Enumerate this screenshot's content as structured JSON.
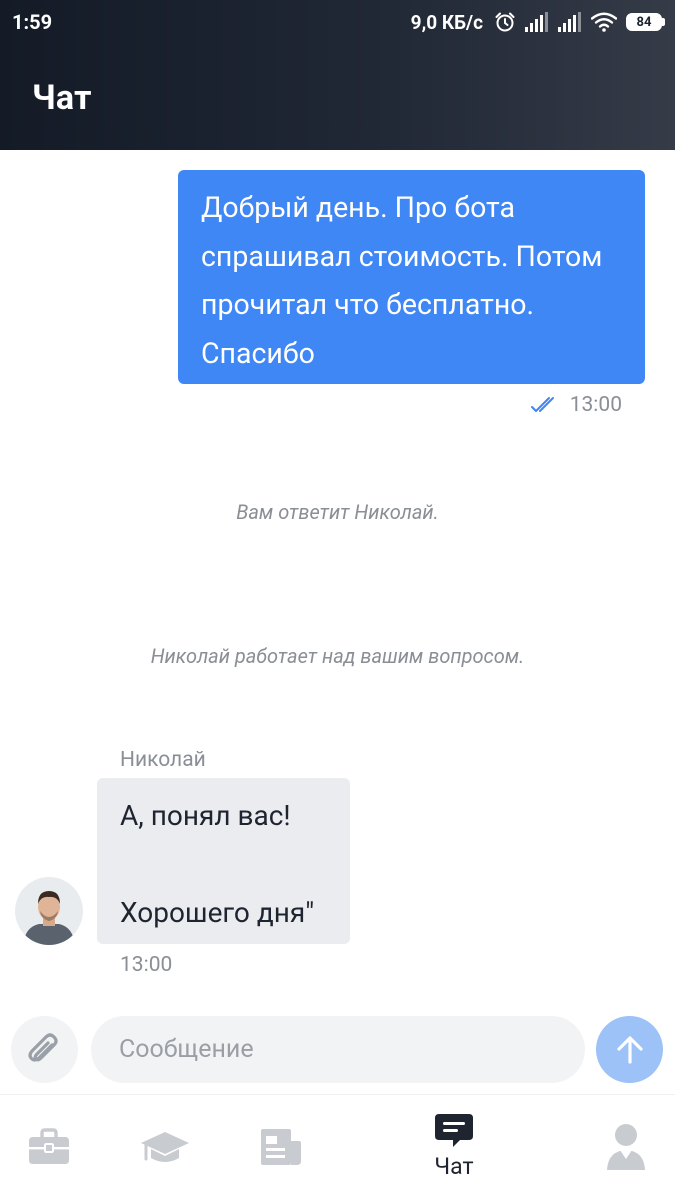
{
  "status_bar": {
    "time": "1:59",
    "net_speed": "9,0 КБ/с",
    "battery": "84",
    "icons": [
      "alarm-icon",
      "signal-icon",
      "signal-icon",
      "wifi-icon",
      "battery-icon"
    ]
  },
  "header": {
    "title": "Чат"
  },
  "messages": {
    "outgoing": {
      "lines": [
        "Добрый день. Про бота",
        "спрашивал стоимость. Потом",
        "прочитал что бесплатно.",
        "Спасибо"
      ],
      "time": "13:00",
      "status_icon": "double-check-icon"
    },
    "system": [
      "Вам ответит Николай.",
      "Николай работает над вашим вопросом."
    ],
    "incoming": {
      "author": "Николай",
      "line1": "А, понял вас!",
      "line2": "Хорошего дня\"",
      "time": "13:00"
    }
  },
  "composer": {
    "placeholder": "Сообщение",
    "attach_icon": "paperclip-icon",
    "send_icon": "arrow-up-icon"
  },
  "bottom_nav": {
    "items": [
      {
        "icon": "briefcase-icon",
        "label": ""
      },
      {
        "icon": "graduation-cap-icon",
        "label": ""
      },
      {
        "icon": "document-icon",
        "label": ""
      },
      {
        "icon": "chat-icon",
        "label": "Чат",
        "active": true
      },
      {
        "icon": "profile-icon",
        "label": ""
      }
    ]
  },
  "colors": {
    "header_start": "#141b27",
    "header_end": "#353b47",
    "outgoing_bubble": "#3f87f5",
    "incoming_bubble": "#ebecef",
    "send_button": "#9dc2f7",
    "muted_text": "#8a8e95",
    "nav_inactive": "#c8cbd0"
  }
}
